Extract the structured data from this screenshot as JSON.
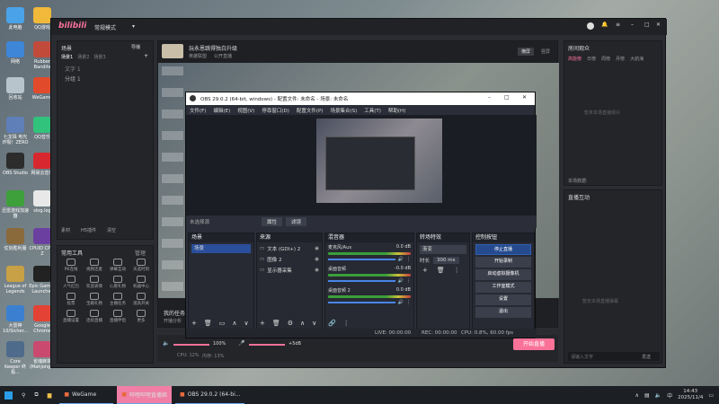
{
  "desktop_icons": [
    {
      "label": "此电脑",
      "color": "#4aa3e8"
    },
    {
      "label": "QQ游戏",
      "color": "#f0b93a"
    },
    {
      "label": "网络",
      "color": "#3d86d8"
    },
    {
      "label": "Rubber Bandits",
      "color": "#c24a3b"
    },
    {
      "label": "回收站",
      "color": "#b8c4cc"
    },
    {
      "label": "WeGame",
      "color": "#e14b2b"
    },
    {
      "label": "七龙珠 电光炸裂！ZERO",
      "color": "#5f7fb8"
    },
    {
      "label": "QQ音乐",
      "color": "#31c27c"
    },
    {
      "label": "OBS Studio",
      "color": "#2c2c2c"
    },
    {
      "label": "网易云音乐",
      "color": "#d7282f"
    },
    {
      "label": "迅雷游戏加速器",
      "color": "#3da03a"
    },
    {
      "label": "slog.log",
      "color": "#e8e8e8"
    },
    {
      "label": "仗剑胜利服",
      "color": "#8a6a3b"
    },
    {
      "label": "CPUID CPU-Z",
      "color": "#6b3fa0"
    },
    {
      "label": "League of Legends",
      "color": "#c8a045"
    },
    {
      "label": "Epic Games Launcher",
      "color": "#222222"
    },
    {
      "label": "大雷神 10/Sicher...",
      "color": "#3b7fd0"
    },
    {
      "label": "Google Chrome",
      "color": "#e34234"
    },
    {
      "label": "Core Keeper 终极...",
      "color": "#4e6b8b"
    },
    {
      "label": "雀魂麻将 (Mahjong...",
      "color": "#c94a6e"
    }
  ],
  "bili": {
    "logo": "bilibili",
    "mode": "常规模式",
    "left": {
      "title": "场景",
      "import": "导播",
      "tabs": [
        "场景1",
        "场景2",
        "场景3"
      ],
      "source_placeholder": "文字 1",
      "group": "分组 1",
      "tools": [
        "素材",
        "H5插件",
        "清空"
      ],
      "common_title": "常用工具",
      "manage": "管理",
      "tools_grid": [
        "PK连线",
        "视频连麦",
        "弹幕互动",
        "天选时刻",
        "人气红包",
        "欢迎表情",
        "心愿礼物",
        "机器中心",
        "投票",
        "宝箱礼物",
        "主播任务",
        "道具开关",
        "直播设置",
        "连续直播",
        "直播伴侣",
        "更多"
      ]
    },
    "stream": {
      "title": "玩永恩跳得独白升级",
      "tag1": "英雄联盟",
      "tag2": "公开直播",
      "btn_rec": "横屏",
      "btn_portrait": "竖屏",
      "task_title": "我的任务",
      "task_desc": "开播分析"
    },
    "bottom": {
      "vol1": "100%",
      "vol2": "+5dB",
      "cpu": "CPU: 12%",
      "mem": "内存: 13%",
      "start": "开始直播"
    },
    "right": {
      "rank_title": "房间观众",
      "rank_tabs": [
        "高能榜",
        "日榜",
        "周榜",
        "月榜",
        "大航海"
      ],
      "rank_empty": "暂未本场直播观众",
      "live_data": "本场数据:",
      "interact_title": "直播互动",
      "interact_empty": "暂无本场直播弹幕",
      "input_placeholder": "请输入文字",
      "send": "发送"
    }
  },
  "obs": {
    "title": "OBS 29.0.2 (64-bit, windows) - 配置文件: 未命名 - 场景: 未命名",
    "menu": [
      "文件(F)",
      "编辑(E)",
      "视图(V)",
      "停靠窗口(D)",
      "配置文件(P)",
      "场景集合(S)",
      "工具(T)",
      "帮助(H)"
    ],
    "source_bar": "未选择源",
    "prop": "属性",
    "filter": "滤镜",
    "scenes": {
      "title": "场景",
      "items": [
        "场景"
      ]
    },
    "sources": {
      "title": "来源",
      "items": [
        "文本 (GDI+) 2",
        "图像 2",
        "显示器采集"
      ]
    },
    "mixer": {
      "title": "混音器",
      "channels": [
        {
          "name": "麦克风/Aux",
          "db": "0.0 dB"
        },
        {
          "name": "桌面音频",
          "db": "-0.0 dB"
        },
        {
          "name": "桌面音频 2",
          "db": "0.0 dB"
        }
      ]
    },
    "transitions": {
      "title": "转场特效",
      "type": "渐变",
      "dur_label": "时长",
      "duration": "300 ms"
    },
    "controls": {
      "title": "控制按钮",
      "items": [
        "停止直播",
        "开始录制",
        "启动虚拟摄像机",
        "工作室模式",
        "设置",
        "退出"
      ]
    },
    "status": {
      "live": "LIVE: 00:00:00",
      "rec": "REC: 00:00:00",
      "cpu": "CPU: 0.8%, 60.00 fps"
    }
  },
  "taskbar": {
    "apps": [
      "WeGame",
      "哔哩哔哩直播姬",
      "OBS 29.0.2 (64-bi..."
    ],
    "time": "14:43",
    "date": "2025/11/4",
    "lang": "中"
  }
}
